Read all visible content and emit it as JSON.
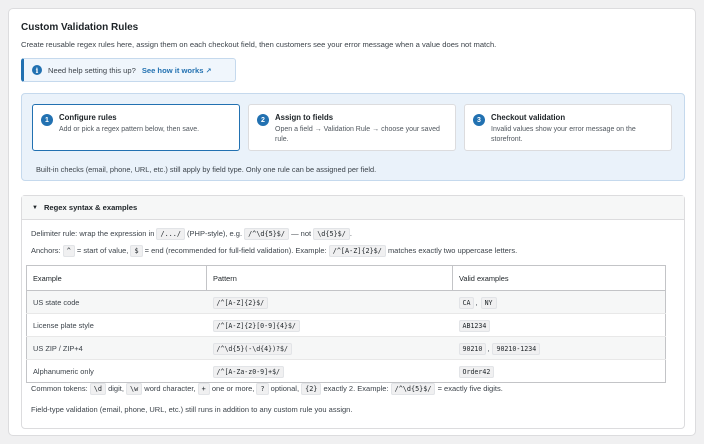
{
  "page": {
    "title": "Custom Validation Rules",
    "description": "Create reusable regex rules here, assign them on each checkout field, then customers see your error message when a value does not match."
  },
  "notice": {
    "icon": "info-icon",
    "text": "Need help setting this up?",
    "link": "See how it works",
    "link_icon": "↗"
  },
  "steps": [
    {
      "number": "1",
      "title": "Configure rules",
      "desc": "Add or pick a regex pattern below, then save."
    },
    {
      "number": "2",
      "title": "Assign to fields",
      "desc": "Open a field → Validation Rule → choose your saved rule."
    },
    {
      "number": "3",
      "title": "Checkout validation",
      "desc": "Invalid values show your error message on the storefront."
    }
  ],
  "steps_note": "Built-in checks (email, phone, URL, etc.) still apply by field type. Only one rule can be assigned per field.",
  "accordion": {
    "title": "Regex syntax & examples",
    "delimiter": {
      "pre": "Delimiter rule: wrap the expression in",
      "code1": "/.../",
      "mid": "(PHP-style), e.g.",
      "code2": "/^\\d{5}$/",
      "mid2": "— not",
      "code3": "\\d{5}$/",
      "end": "."
    },
    "anchors": {
      "pre": "Anchors:",
      "code1": "^",
      "mid1": "= start of value,",
      "code2": "$",
      "mid2": "= end (recommended for full-field validation). Example:",
      "code3": "/^[A-Z]{2}$/",
      "end": "matches exactly two uppercase letters."
    },
    "table": {
      "headers": [
        "Example",
        "Pattern",
        "Valid examples"
      ],
      "rows": [
        {
          "example": "US state code",
          "pattern": "/^[A-Z]{2}$/",
          "valid": [
            "CA",
            "NY"
          ]
        },
        {
          "example": "License plate style",
          "pattern": "/^[A-Z]{2}[0-9]{4}$/",
          "valid": [
            "AB1234"
          ]
        },
        {
          "example": "US ZIP / ZIP+4",
          "pattern": "/^\\d{5}(-\\d{4})?$/",
          "valid": [
            "90210",
            "90210-1234"
          ]
        },
        {
          "example": "Alphanumeric only",
          "pattern": "/^[A-Za-z0-9]+$/",
          "valid": [
            "Order42"
          ]
        }
      ]
    },
    "tokens": {
      "pre": "Common tokens:",
      "c1": "\\d",
      "t1": "digit,",
      "c2": "\\w",
      "t2": "word character,",
      "c3": "+",
      "t3": "one or more,",
      "c4": "?",
      "t4": "optional,",
      "c5": "{2}",
      "t5": "exactly 2. Example:",
      "c6": "/^\\d{5}$/",
      "t6": "= exactly five digits."
    },
    "footer_note": "Field-type validation (email, phone, URL, etc.) still runs in addition to any custom rule you assign."
  }
}
